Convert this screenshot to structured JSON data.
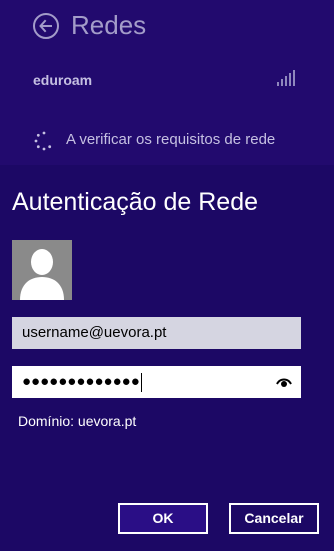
{
  "header": {
    "title": "Redes",
    "back_icon": "back-arrow-icon"
  },
  "network": {
    "name": "eduroam",
    "signal_icon": "signal-strength-icon",
    "status_text": "A verificar os requisitos de rede"
  },
  "dialog": {
    "title": "Autenticação de Rede",
    "avatar_icon": "user-avatar-icon",
    "username_value": "username@uevora.pt",
    "password_value": "●●●●●●●●●●●●●",
    "reveal_icon": "eye-icon",
    "domain_text": "Domínio: uevora.pt",
    "ok_label": "OK",
    "cancel_label": "Cancelar"
  },
  "colors": {
    "background": "#1c0865",
    "top_panel": "#220a6e",
    "muted_text": "#a39cc9"
  }
}
